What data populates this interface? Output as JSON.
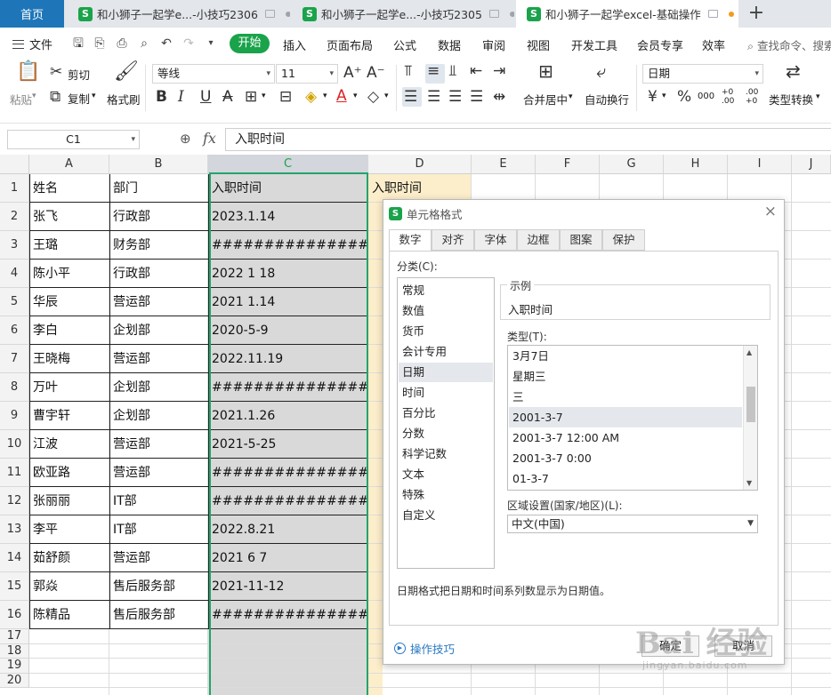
{
  "tabs": {
    "home": "首页",
    "items": [
      {
        "label": "和小狮子一起学e...-小技巧2306",
        "active": false
      },
      {
        "label": "和小狮子一起学e...-小技巧2305",
        "active": false
      },
      {
        "label": "和小狮子一起学excel-基础操作",
        "active": true
      }
    ],
    "logo_letter": "S",
    "add": "+"
  },
  "menu": {
    "file": "文件",
    "start": "开始",
    "items": [
      "插入",
      "页面布局",
      "公式",
      "数据",
      "审阅",
      "视图",
      "开发工具",
      "会员专享",
      "效率"
    ],
    "search": "查找命令、搜索"
  },
  "ribbon": {
    "paste": "粘贴",
    "cut": "剪切",
    "copy": "复制",
    "format_painter": "格式刷",
    "font_name": "等线",
    "font_size": "11",
    "merge": "合并居中",
    "wrap": "自动换行",
    "number_format": "日期",
    "type_convert": "类型转换",
    "currency": "¥",
    "percent": "%",
    "thousands": "000",
    "dec_inc": "+0 .00",
    "dec_dec": ".00 +0"
  },
  "formula_bar": {
    "name_box": "C1",
    "fx": "fx",
    "content": "入职时间"
  },
  "sheet": {
    "columns": [
      "A",
      "B",
      "C",
      "D",
      "E",
      "F",
      "G",
      "H",
      "I",
      "J"
    ],
    "row_numbers": [
      "1",
      "2",
      "3",
      "4",
      "5",
      "6",
      "7",
      "8",
      "9",
      "10",
      "11",
      "12",
      "13",
      "14",
      "15",
      "16",
      "17",
      "18",
      "19",
      "20"
    ],
    "rows": [
      [
        "姓名",
        "部门",
        "入职时间",
        "入职时间"
      ],
      [
        "张飞",
        "行政部",
        "2023.1.14"
      ],
      [
        "王璐",
        "财务部",
        "######################"
      ],
      [
        "陈小平",
        "行政部",
        "2022 1 18"
      ],
      [
        "华辰",
        "营运部",
        "2021 1.14"
      ],
      [
        "李白",
        "企划部",
        "2020-5-9"
      ],
      [
        "王晓梅",
        "营运部",
        "2022.11.19"
      ],
      [
        "万叶",
        "企划部",
        "######################"
      ],
      [
        "曹宇轩",
        "企划部",
        "2021.1.26"
      ],
      [
        "江波",
        "营运部",
        "2021-5-25"
      ],
      [
        "欧亚路",
        "营运部",
        "######################"
      ],
      [
        "张丽丽",
        "IT部",
        "######################"
      ],
      [
        "李平",
        "IT部",
        "2022.8.21"
      ],
      [
        "茹舒颜",
        "营运部",
        "2021 6 7"
      ],
      [
        "郭焱",
        "售后服务部",
        "2021-11-12"
      ],
      [
        "陈精品",
        "售后服务部",
        "######################"
      ]
    ]
  },
  "dialog": {
    "title": "单元格格式",
    "close": "×",
    "tabs": [
      "数字",
      "对齐",
      "字体",
      "边框",
      "图案",
      "保护"
    ],
    "category_label": "分类(C):",
    "categories": [
      "常规",
      "数值",
      "货币",
      "会计专用",
      "日期",
      "时间",
      "百分比",
      "分数",
      "科学记数",
      "文本",
      "特殊",
      "自定义"
    ],
    "selected_category": 4,
    "sample_label": "示例",
    "sample_value": "入职时间",
    "type_label": "类型(T):",
    "types": [
      "3月7日",
      "星期三",
      "三",
      "2001-3-7",
      "2001-3-7 12:00 AM",
      "2001-3-7 0:00",
      "01-3-7"
    ],
    "selected_type": 3,
    "locale_label": "区域设置(国家/地区)(L):",
    "locale_value": "中文(中国)",
    "description": "日期格式把日期和时间系列数显示为日期值。",
    "tips": "操作技巧",
    "ok": "确定",
    "cancel": "取消"
  },
  "watermark": {
    "main": "Bai 经验",
    "sub": "jingyan.baidu.com"
  }
}
